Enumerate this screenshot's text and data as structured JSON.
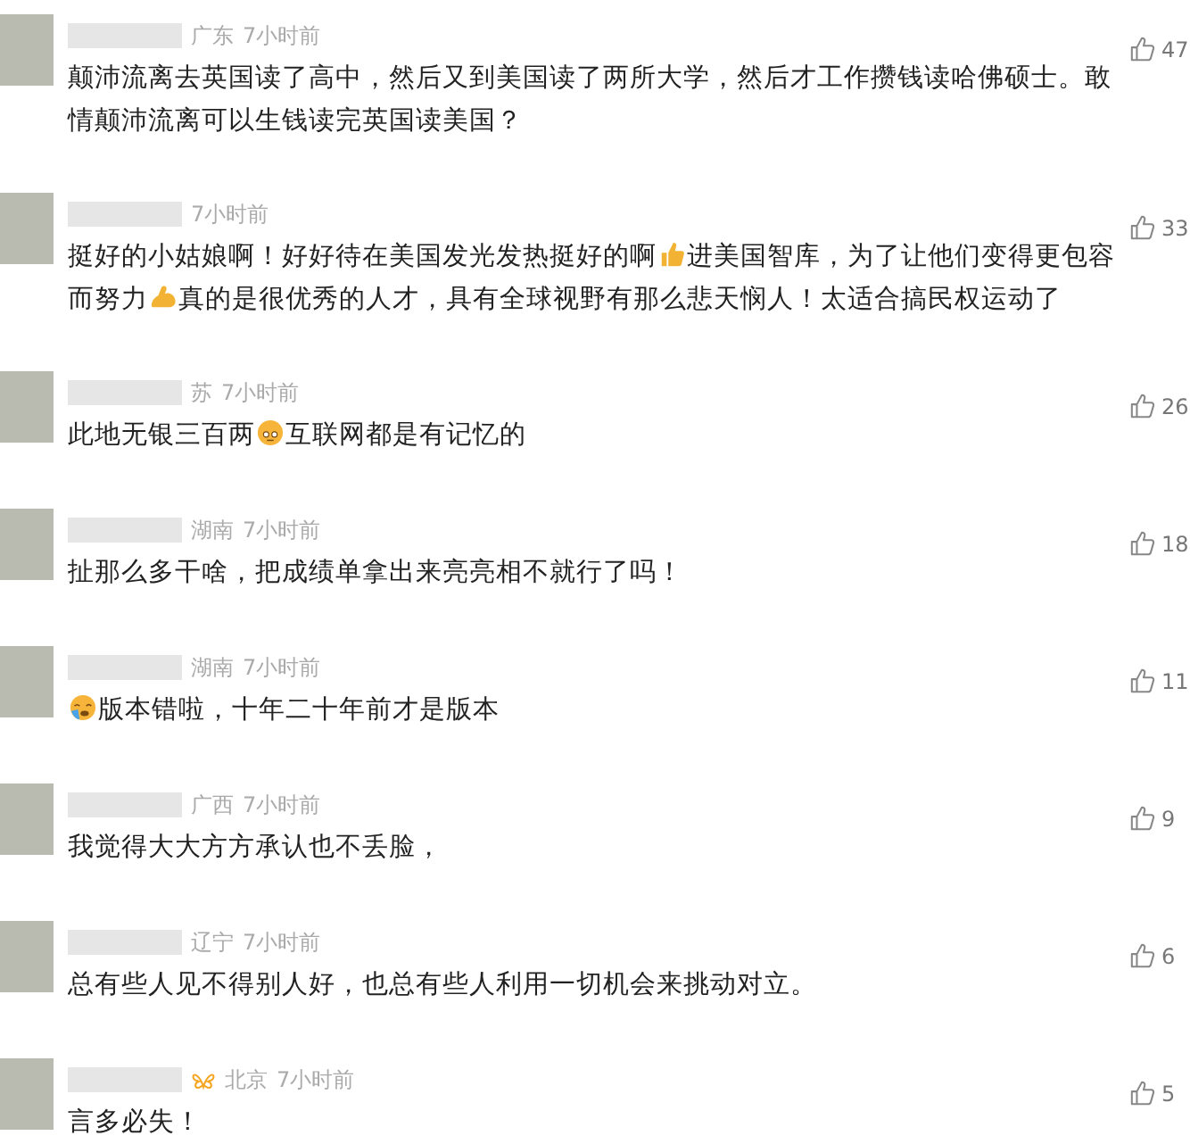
{
  "comments": [
    {
      "location": "广东",
      "time": "7小时前",
      "likes": "47",
      "vip_badge": false,
      "parts": [
        {
          "kind": "text",
          "text": "颠沛流离去英国读了高中，然后又到美国读了两所大学，然后才工作攒钱读哈佛硕士。敢情颠沛流离可以生钱读完英国读美国？"
        }
      ]
    },
    {
      "time": "7小时前",
      "likes": "33",
      "vip_badge": false,
      "parts": [
        {
          "kind": "text",
          "text": "挺好的小姑娘啊！好好待在美国发光发热挺好的啊"
        },
        {
          "kind": "thumb"
        },
        {
          "kind": "text",
          "text": "进美国智库，为了让他们变得更包容而努力"
        },
        {
          "kind": "arm"
        },
        {
          "kind": "text",
          "text": "真的是很优秀的人才，具有全球视野有那么悲天悯人！太适合搞民权运动了"
        }
      ]
    },
    {
      "location": "苏",
      "time": "7小时前",
      "likes": "26",
      "vip_badge": false,
      "parts": [
        {
          "kind": "text",
          "text": "此地无银三百两"
        },
        {
          "kind": "face"
        },
        {
          "kind": "text",
          "text": "互联网都是有记忆的"
        }
      ]
    },
    {
      "location": "湖南",
      "time": "7小时前",
      "likes": "18",
      "vip_badge": false,
      "parts": [
        {
          "kind": "text",
          "text": "扯那么多干啥，把成绩单拿出来亮亮相不就行了吗！"
        }
      ]
    },
    {
      "location": "湖南",
      "time": "7小时前",
      "likes": "11",
      "vip_badge": false,
      "parts": [
        {
          "kind": "crying"
        },
        {
          "kind": "text",
          "text": "版本错啦，十年二十年前才是版本"
        }
      ]
    },
    {
      "location": "广西",
      "time": "7小时前",
      "likes": "9",
      "vip_badge": false,
      "parts": [
        {
          "kind": "text",
          "text": "我觉得大大方方承认也不丢脸，"
        }
      ]
    },
    {
      "location": "辽宁",
      "time": "7小时前",
      "likes": "6",
      "vip_badge": false,
      "parts": [
        {
          "kind": "text",
          "text": "总有些人见不得别人好，也总有些人利用一切机会来挑动对立。"
        }
      ]
    },
    {
      "location": "北京",
      "time": "7小时前",
      "likes": "5",
      "vip_badge": true,
      "parts": [
        {
          "kind": "text",
          "text": "言多必失！"
        }
      ]
    }
  ]
}
